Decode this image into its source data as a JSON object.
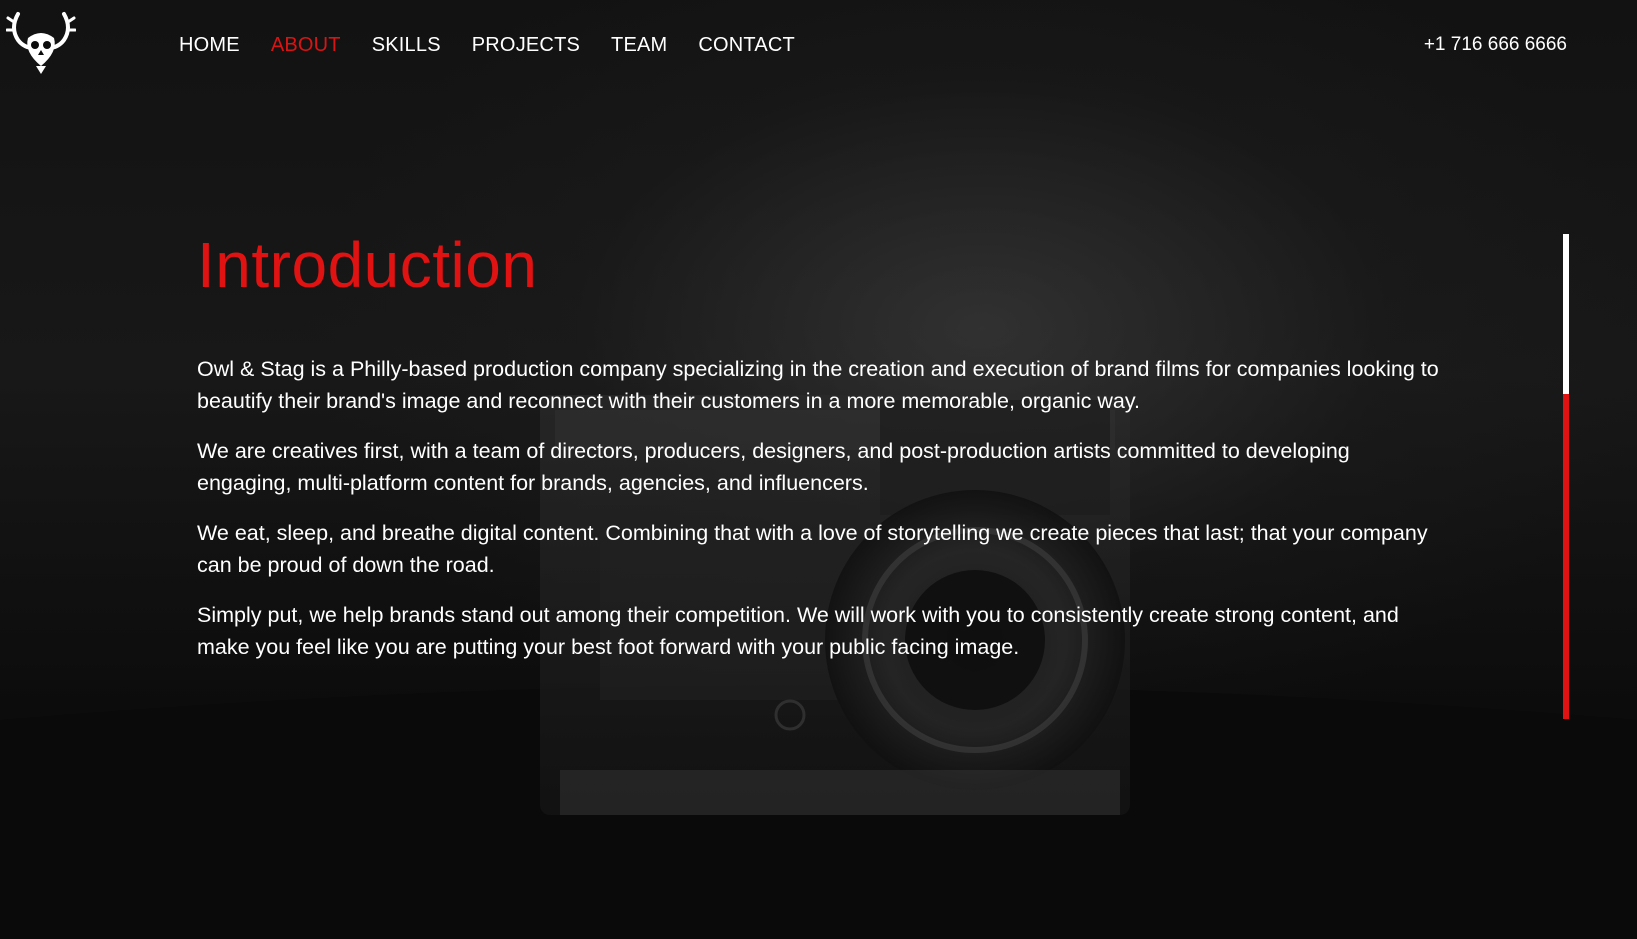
{
  "brand": {
    "logo_icon": "owl-stag-icon"
  },
  "nav": {
    "items": [
      {
        "label": "HOME",
        "active": false
      },
      {
        "label": "ABOUT",
        "active": true
      },
      {
        "label": "SKILLS",
        "active": false
      },
      {
        "label": "PROJECTS",
        "active": false
      },
      {
        "label": "TEAM",
        "active": false
      },
      {
        "label": "CONTACT",
        "active": false
      }
    ]
  },
  "header": {
    "phone": "+1 716 666 6666"
  },
  "section": {
    "title": "Introduction",
    "paragraphs": [
      "Owl & Stag is a Philly-based production company specializing in the creation and execution of brand films for companies looking to beautify their brand's image and reconnect with their customers in a more memorable, organic way.",
      "We are creatives first, with a team of directors, producers, designers, and post-production artists committed to developing engaging, multi-platform content for brands, agencies, and influencers.",
      "We eat, sleep, and breathe digital content. Combining that with a love of storytelling we create pieces that last; that your company can be proud of down the road.",
      "Simply put, we help brands stand out among their competition. We will work with you to consistently create strong content, and make you feel like you are putting your best foot forward with your public facing image."
    ]
  },
  "scroll_indicator": {
    "progress": 0.33
  },
  "colors": {
    "accent": "#e01212",
    "text": "#ffffff",
    "background": "#0b0b0b"
  }
}
